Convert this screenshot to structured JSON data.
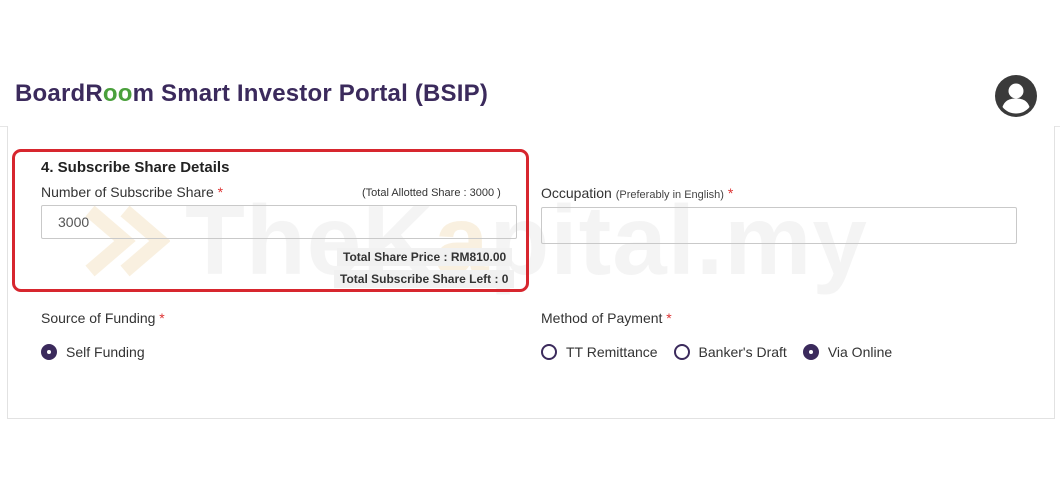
{
  "header": {
    "title_part1": "BoardR",
    "title_oo": "oo",
    "title_part2": "m Smart Investor Portal (BSIP)",
    "avatar_icon": "user-avatar-icon",
    "brand_color": "#3b2a5c",
    "accent_color": "#4aa03c"
  },
  "watermark": {
    "text_before": "TheK",
    "text_k": "a",
    "text_after": "pital.my",
    "icon": "thekapital-logo-icon"
  },
  "subscribe": {
    "section_title": "4. Subscribe Share Details",
    "number_label": "Number of Subscribe Share",
    "required_mark": "*",
    "allotted_note": "(Total Allotted Share : 3000 )",
    "number_value": "3000",
    "total_price": "Total Share Price : RM810.00",
    "shares_left": "Total Subscribe Share Left : 0",
    "highlight_color": "#d7262e"
  },
  "occupation": {
    "label": "Occupation",
    "hint": "(Preferably in English)",
    "required_mark": "*",
    "value": ""
  },
  "funding": {
    "label": "Source of Funding",
    "required_mark": "*",
    "options": [
      {
        "label": "Self Funding",
        "selected": true
      }
    ]
  },
  "payment": {
    "label": "Method of Payment",
    "required_mark": "*",
    "options": [
      {
        "label": "TT Remittance",
        "selected": false
      },
      {
        "label": "Banker's Draft",
        "selected": false
      },
      {
        "label": "Via Online",
        "selected": true
      }
    ]
  }
}
